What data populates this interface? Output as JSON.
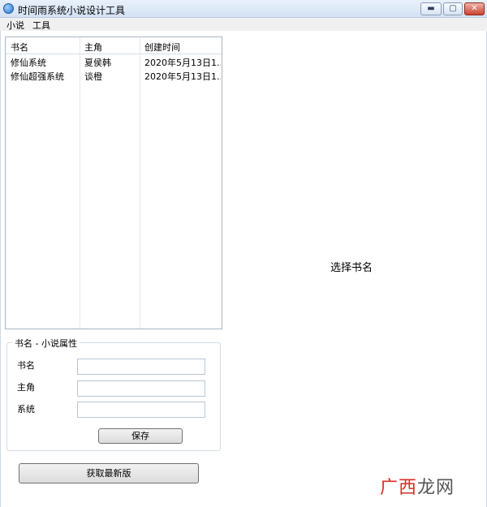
{
  "window": {
    "title": "时间雨系统小说设计工具",
    "controls": {
      "minimize": "▬",
      "maximize": "▢",
      "close": "✕"
    }
  },
  "menu": {
    "items": [
      "小说",
      "工具"
    ]
  },
  "list": {
    "columns": [
      "书名",
      "主角",
      "创建时间"
    ],
    "rows": [
      [
        "修仙系统",
        "夏侯韩",
        "2020年5月13日1..."
      ],
      [
        "修仙超强系统",
        "谈橙",
        "2020年5月13日1..."
      ]
    ]
  },
  "properties": {
    "title": "书名 - 小说属性",
    "fields": [
      {
        "label": "书名",
        "value": ""
      },
      {
        "label": "主角",
        "value": ""
      },
      {
        "label": "系统",
        "value": ""
      }
    ],
    "save_label": "保存"
  },
  "update_label": "获取最新版",
  "placeholder": "选择书名",
  "watermark": {
    "red": "广西",
    "gray": "龙网"
  },
  "colors": {
    "accent": "#2a6fc9",
    "watermark_red": "#d92d27",
    "close": "#c9432f"
  }
}
